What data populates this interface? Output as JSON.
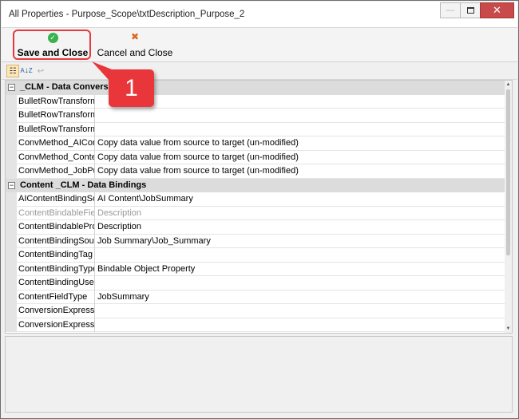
{
  "window": {
    "title": "All Properties - Purpose_Scope\\txtDescription_Purpose_2",
    "minimize_glyph": "—",
    "close_glyph": "✕"
  },
  "toolbar": {
    "save_label": "Save and Close",
    "cancel_label": "Cancel and Close",
    "save_icon": "check-circle-icon",
    "cancel_icon": "x-icon",
    "save_icon_glyph": "✓",
    "cancel_icon_glyph": "✖"
  },
  "callout": {
    "number": "1"
  },
  "subbar": {
    "categorized_glyph": "☷",
    "alpha_glyph_top": "A",
    "alpha_glyph_bottom": "Z",
    "pages_glyph": "↩"
  },
  "grid": {
    "categories": [
      {
        "label": "_CLM - Data Conversion",
        "toggle": "−",
        "rows": [
          {
            "name": "BulletRowTransformation",
            "value": ""
          },
          {
            "name": "BulletRowTransformation",
            "value": ""
          },
          {
            "name": "BulletRowTransformation",
            "value": ""
          },
          {
            "name": "ConvMethod_AIContent",
            "value": "Copy data value from source to target (un-modified)"
          },
          {
            "name": "ConvMethod_Content",
            "value": "Copy data value from source to target (un-modified)"
          },
          {
            "name": "ConvMethod_JobPurpose",
            "value": "Copy data value from source to target (un-modified)"
          }
        ]
      },
      {
        "label": "Content _CLM - Data Bindings",
        "toggle": "−",
        "rows": [
          {
            "name": "AIContentBindingSource",
            "value": "AI Content\\JobSummary"
          },
          {
            "name": "ContentBindableField",
            "value": "Description",
            "dim": true
          },
          {
            "name": "ContentBindableProperty",
            "value": "Description"
          },
          {
            "name": "ContentBindingSource",
            "value": "Job Summary\\Job_Summary"
          },
          {
            "name": "ContentBindingTag",
            "value": ""
          },
          {
            "name": "ContentBindingType",
            "value": "Bindable Object Property"
          },
          {
            "name": "ContentBindingUsed",
            "value": ""
          },
          {
            "name": "ContentFieldType",
            "value": "JobSummary"
          },
          {
            "name": "ConversionExpression",
            "value": ""
          },
          {
            "name": "ConversionExpression",
            "value": ""
          }
        ]
      }
    ]
  },
  "colors": {
    "highlight": "#e5393d",
    "callout": "#e9363a",
    "save_icon": "#38b24c",
    "cancel_icon": "#e0661d",
    "close_button": "#c94a4a"
  }
}
